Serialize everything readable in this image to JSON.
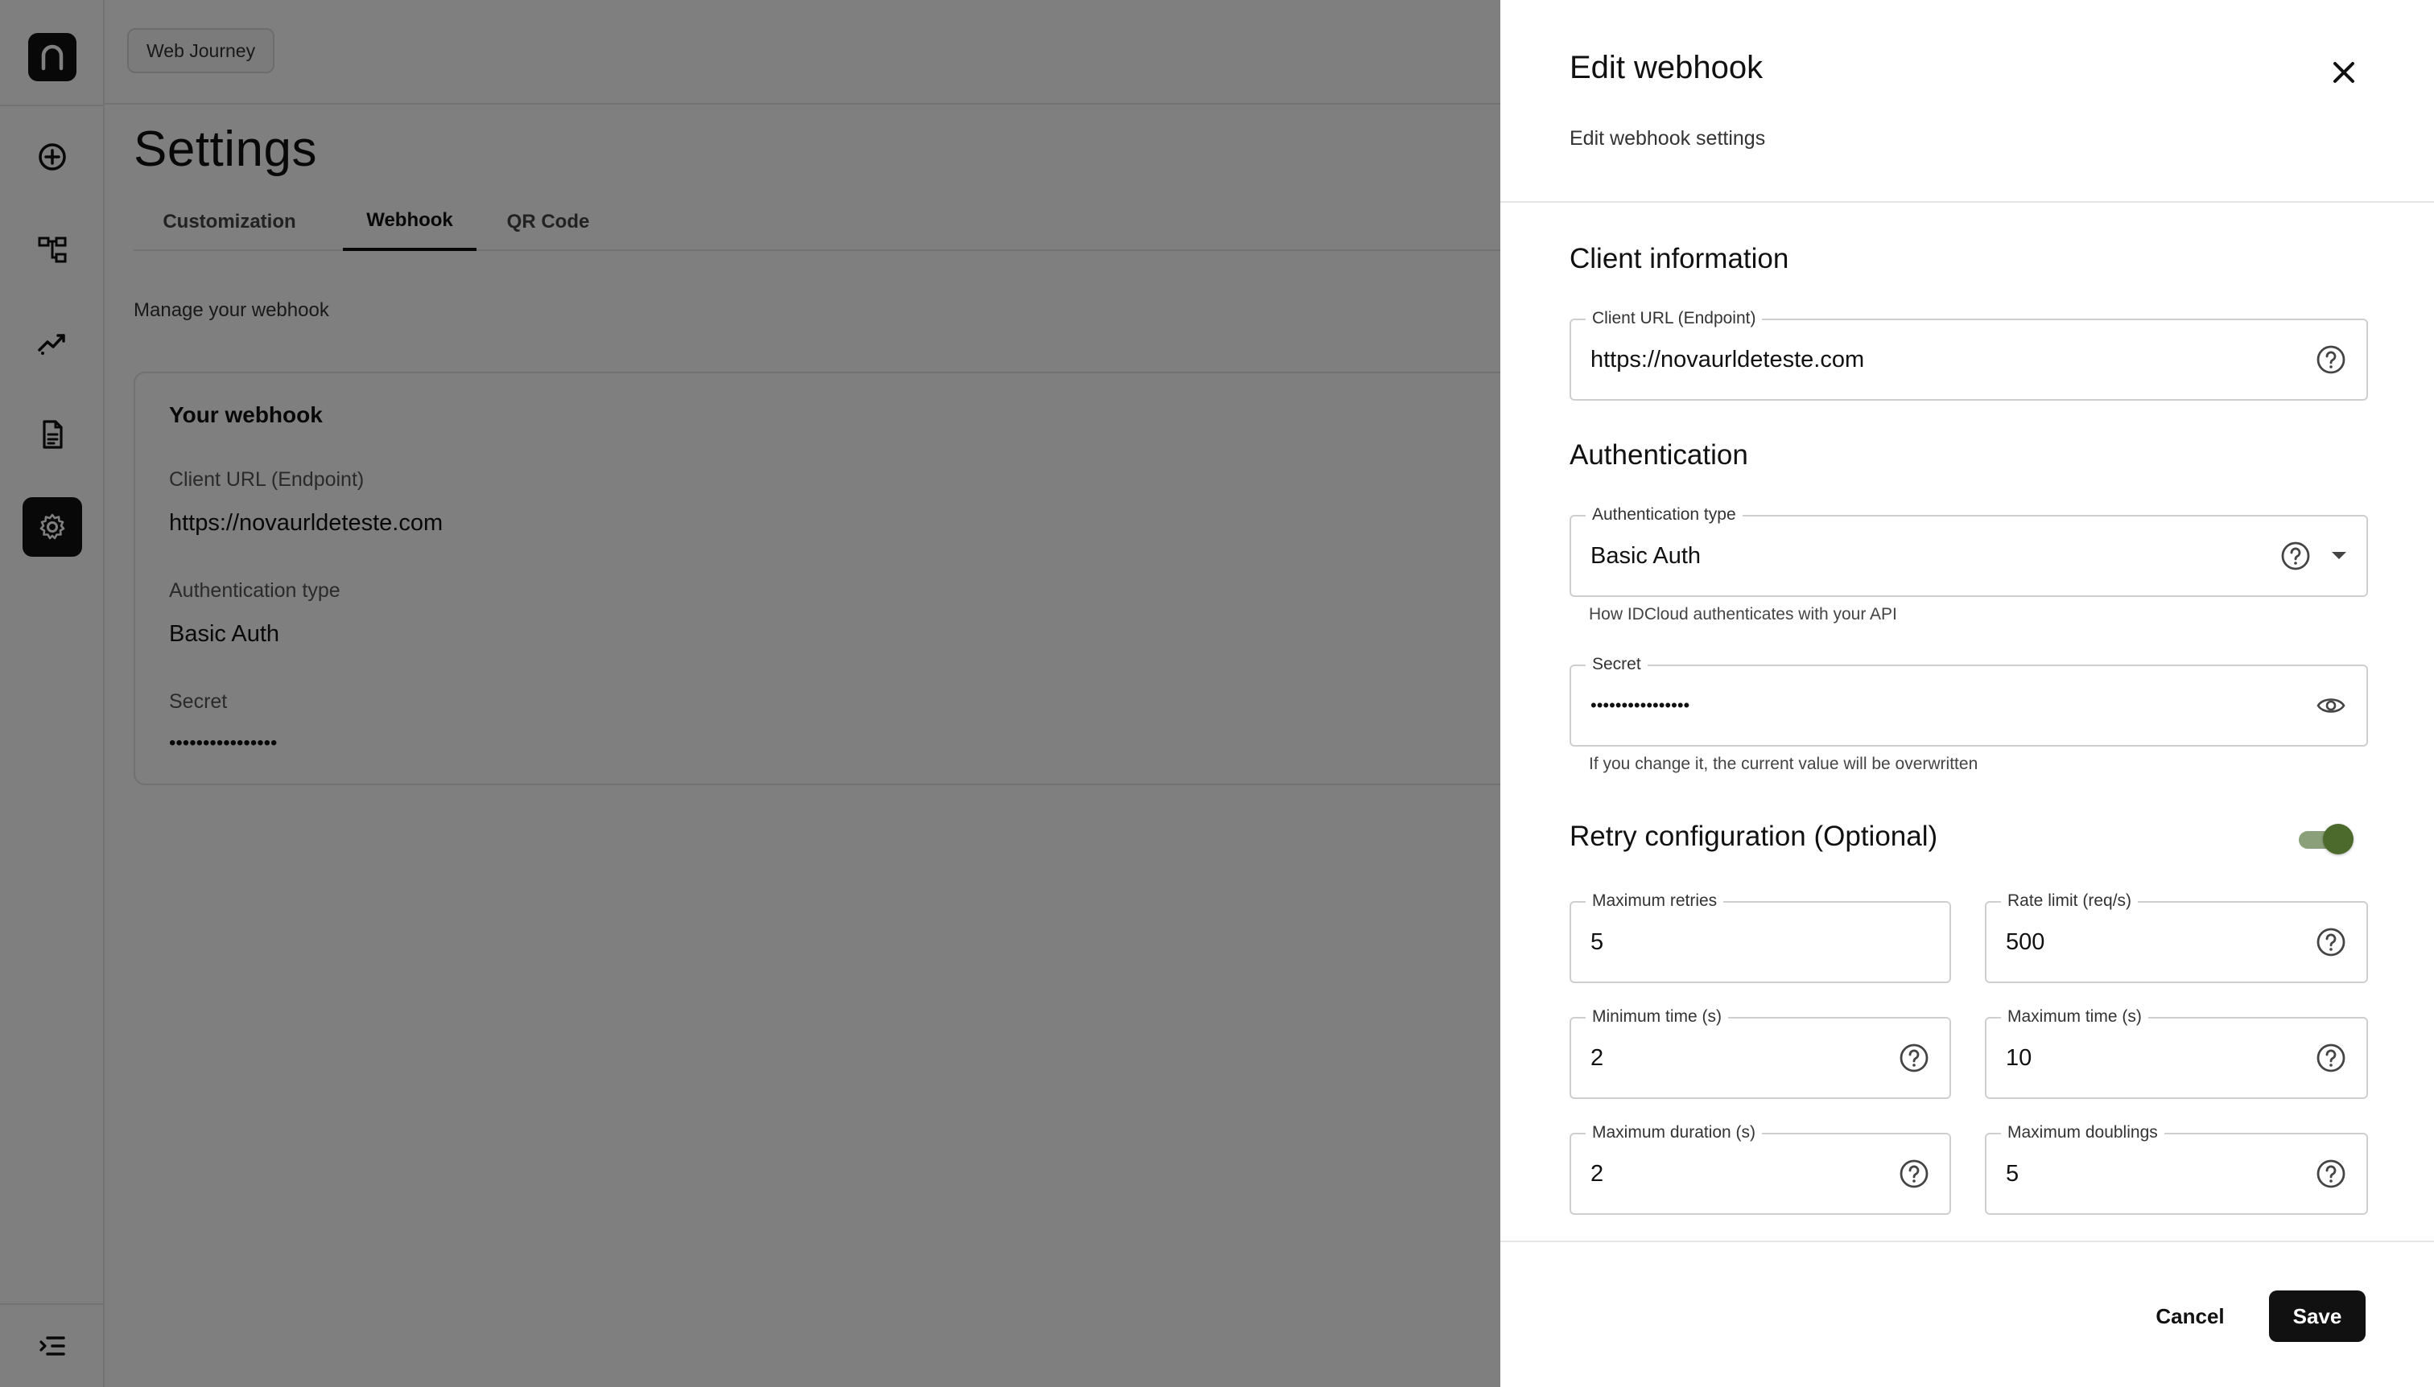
{
  "rail": {
    "logo_icon": "n-logo-icon",
    "items": [
      {
        "name": "add-icon"
      },
      {
        "name": "flow-icon"
      },
      {
        "name": "analytics-icon"
      },
      {
        "name": "document-icon"
      },
      {
        "name": "gear-icon",
        "active": true
      }
    ],
    "collapse_icon": "menu-collapse-icon"
  },
  "topbar": {
    "journey_label": "Web Journey"
  },
  "page": {
    "title": "Settings",
    "tabs": [
      {
        "label": "Customization"
      },
      {
        "label": "Webhook",
        "active": true
      },
      {
        "label": "QR Code"
      }
    ],
    "manage_text": "Manage your webhook",
    "card": {
      "title": "Your webhook",
      "client_url_label": "Client URL (Endpoint)",
      "client_url_value": "https://novaurldeteste.com",
      "auth_type_label": "Authentication type",
      "auth_type_value": "Basic Auth",
      "secret_label": "Secret",
      "secret_value": "••••••••••••••••"
    }
  },
  "drawer": {
    "title": "Edit webhook",
    "subtitle": "Edit webhook settings",
    "client_section": "Client information",
    "client_url": {
      "label": "Client URL (Endpoint)",
      "value": "https://novaurldeteste.com"
    },
    "auth_section": "Authentication",
    "auth_type": {
      "label": "Authentication type",
      "value": "Basic Auth",
      "helper": "How IDCloud authenticates with your API"
    },
    "secret": {
      "label": "Secret",
      "value": "••••••••••••••••",
      "helper": "If you change it, the current value will be overwritten"
    },
    "retry_section": "Retry configuration (Optional)",
    "retry_enabled": true,
    "max_retries": {
      "label": "Maximum retries",
      "value": "5"
    },
    "rate_limit": {
      "label": "Rate limit (req/s)",
      "value": "500"
    },
    "min_time": {
      "label": "Minimum time (s)",
      "value": "2"
    },
    "max_time": {
      "label": "Maximum time (s)",
      "value": "10"
    },
    "max_duration": {
      "label": "Maximum duration (s)",
      "value": "2"
    },
    "max_doublings": {
      "label": "Maximum doublings",
      "value": "5"
    },
    "cancel_label": "Cancel",
    "save_label": "Save"
  },
  "colors": {
    "accent": "#111111",
    "toggle_knob": "#4c6a2c",
    "toggle_track": "#8aa07a",
    "overlay": "rgba(0,0,0,0.5)"
  }
}
